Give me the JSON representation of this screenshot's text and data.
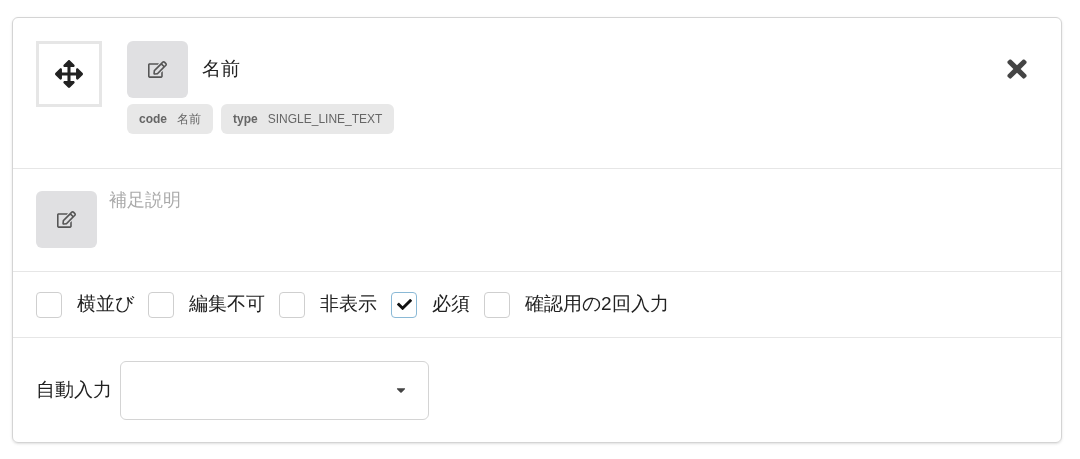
{
  "field": {
    "title": "名前",
    "badges": [
      {
        "key": "code",
        "value": "名前"
      },
      {
        "key": "type",
        "value": "SINGLE_LINE_TEXT"
      }
    ]
  },
  "description": {
    "placeholder": "補足説明"
  },
  "options": [
    {
      "label": "横並び",
      "checked": false
    },
    {
      "label": "編集不可",
      "checked": false
    },
    {
      "label": "非表示",
      "checked": false
    },
    {
      "label": "必須",
      "checked": true
    },
    {
      "label": "確認用の2回入力",
      "checked": false
    }
  ],
  "auto_input": {
    "label": "自動入力"
  }
}
